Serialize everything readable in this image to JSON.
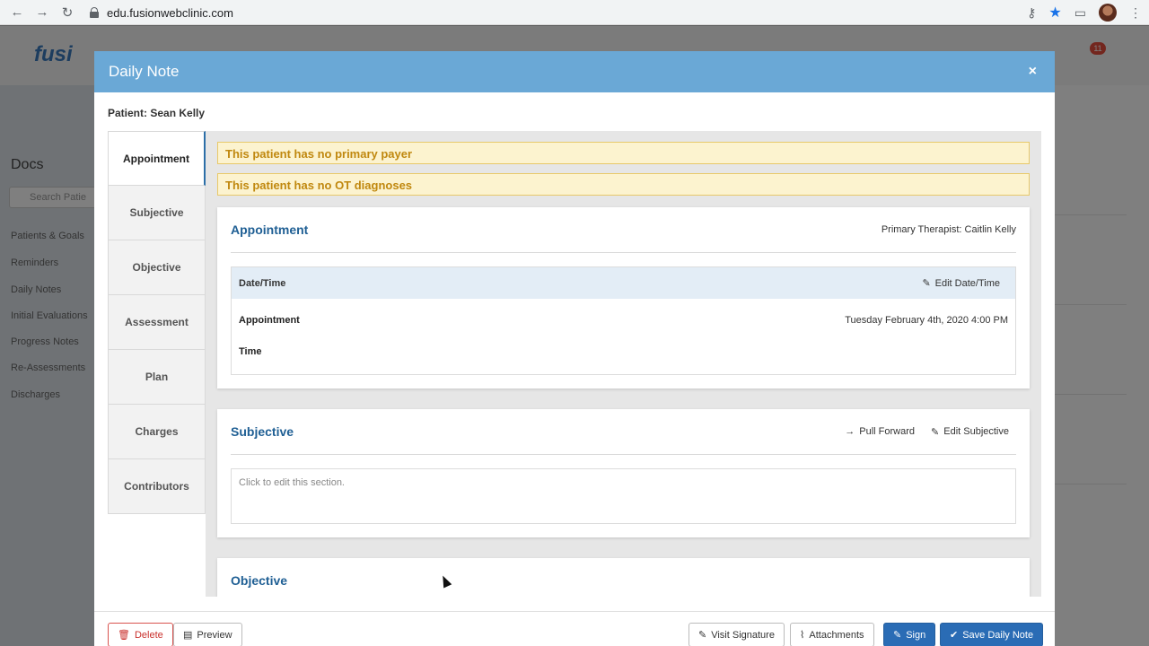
{
  "browser": {
    "url": "edu.fusionwebclinic.com",
    "back": "←",
    "forward": "→",
    "reload": "↻",
    "key": "⚷",
    "star": "★",
    "menu": "⋮"
  },
  "app": {
    "logo": "fusi",
    "section": "Docs",
    "search_placeholder": "Search Patie",
    "notification_count": "11",
    "side_links": [
      "Patients & Goals",
      "Reminders",
      "Daily Notes",
      "Initial Evaluations",
      "Progress Notes",
      "Re-Assessments",
      "Discharges"
    ]
  },
  "modal": {
    "title": "Daily Note",
    "close": "×",
    "patient": "Patient: Sean Kelly",
    "tabs": [
      "Appointment",
      "Subjective",
      "Objective",
      "Assessment",
      "Plan",
      "Charges",
      "Contributors"
    ],
    "alerts": [
      "This patient has no primary payer",
      "This patient has no OT diagnoses"
    ],
    "appointment": {
      "title": "Appointment",
      "therapist": "Primary Therapist: Caitlin Kelly",
      "datetime_label": "Date/Time",
      "edit_datetime": "Edit Date/Time",
      "row1_label": "Appointment",
      "row1_value": "Tuesday February 4th, 2020 4:00 PM",
      "row2_label": "Time"
    },
    "subjective": {
      "title": "Subjective",
      "pull_forward": "Pull Forward",
      "edit": "Edit Subjective",
      "placeholder": "Click to edit this section."
    },
    "objective": {
      "title": "Objective"
    },
    "footer": {
      "delete": "Delete",
      "preview": "Preview",
      "visit_signature": "Visit Signature",
      "attachments": "Attachments",
      "sign": "Sign",
      "save": "Save Daily Note"
    }
  }
}
